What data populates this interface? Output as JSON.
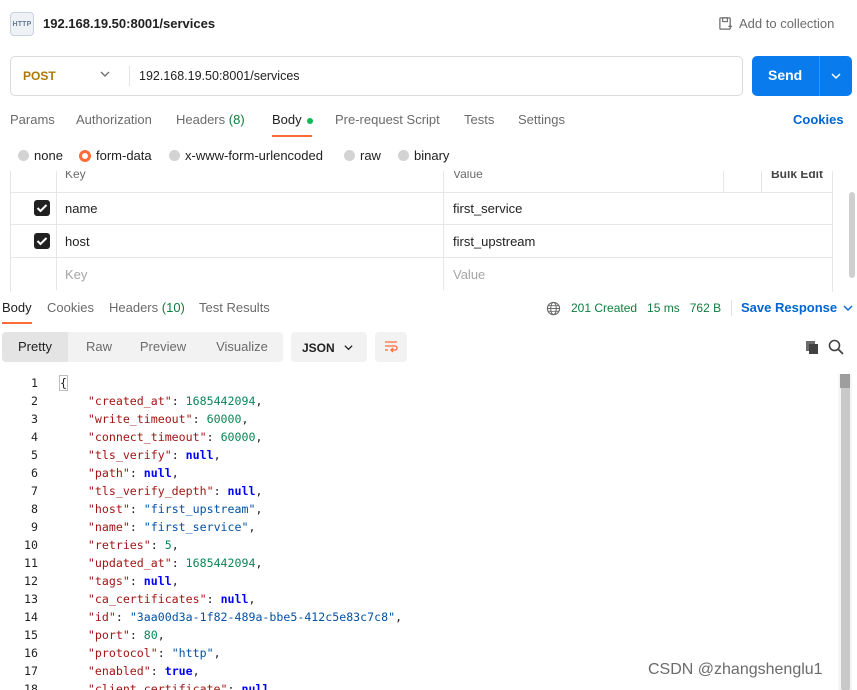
{
  "request": {
    "title": "192.168.19.50:8001/services",
    "icon_label": "HTTP",
    "add_to_collection": "Add to collection",
    "method": "POST",
    "url": "192.168.19.50:8001/services",
    "send_label": "Send"
  },
  "req_tabs": {
    "params": "Params",
    "authorization": "Authorization",
    "headers": "Headers",
    "headers_count": "(8)",
    "body": "Body",
    "pre_request": "Pre-request Script",
    "tests": "Tests",
    "settings": "Settings",
    "cookies": "Cookies"
  },
  "body_modes": {
    "none": "none",
    "form_data": "form-data",
    "urlencoded": "x-www-form-urlencoded",
    "raw": "raw",
    "binary": "binary",
    "selected": "form-data"
  },
  "form_table": {
    "headers": [
      "Key",
      "Value",
      "Bulk Edit"
    ],
    "rows": [
      {
        "key": "name",
        "value": "first_service",
        "checked": true
      },
      {
        "key": "host",
        "value": "first_upstream",
        "checked": true
      }
    ],
    "placeholder_key": "Key",
    "placeholder_value": "Value"
  },
  "response": {
    "tabs": {
      "body": "Body",
      "cookies": "Cookies",
      "headers": "Headers",
      "headers_count": "(10)",
      "test_results": "Test Results"
    },
    "status": "201 Created",
    "time": "15 ms",
    "size": "762 B",
    "save_response": "Save Response",
    "views": {
      "pretty": "Pretty",
      "raw": "Raw",
      "preview": "Preview",
      "visualize": "Visualize"
    },
    "format": "JSON"
  },
  "code_lines": [
    {
      "num": "1",
      "type": "open",
      "text": "{"
    },
    {
      "num": "2",
      "type": "num",
      "key": "created_at",
      "value": "1685442094"
    },
    {
      "num": "3",
      "type": "num",
      "key": "write_timeout",
      "value": "60000"
    },
    {
      "num": "4",
      "type": "num",
      "key": "connect_timeout",
      "value": "60000"
    },
    {
      "num": "5",
      "type": "null",
      "key": "tls_verify",
      "value": "null"
    },
    {
      "num": "6",
      "type": "null",
      "key": "path",
      "value": "null"
    },
    {
      "num": "7",
      "type": "null",
      "key": "tls_verify_depth",
      "value": "null"
    },
    {
      "num": "8",
      "type": "str",
      "key": "host",
      "value": "first_upstream"
    },
    {
      "num": "9",
      "type": "str",
      "key": "name",
      "value": "first_service"
    },
    {
      "num": "10",
      "type": "num",
      "key": "retries",
      "value": "5"
    },
    {
      "num": "11",
      "type": "num",
      "key": "updated_at",
      "value": "1685442094"
    },
    {
      "num": "12",
      "type": "null",
      "key": "tags",
      "value": "null"
    },
    {
      "num": "13",
      "type": "null",
      "key": "ca_certificates",
      "value": "null"
    },
    {
      "num": "14",
      "type": "str",
      "key": "id",
      "value": "3aa00d3a-1f82-489a-bbe5-412c5e83c7c8"
    },
    {
      "num": "15",
      "type": "num",
      "key": "port",
      "value": "80"
    },
    {
      "num": "16",
      "type": "str",
      "key": "protocol",
      "value": "http"
    },
    {
      "num": "17",
      "type": "null",
      "key": "enabled",
      "value": "true"
    },
    {
      "num": "18",
      "type": "null",
      "key": "client_certificate",
      "value": "null"
    }
  ],
  "watermark": "CSDN @zhangshenglu1",
  "colors": {
    "accent_orange": "#ff6c37",
    "send_blue": "#097bed",
    "link_blue": "#0265d2",
    "status_green": "#0f7d3d",
    "method_post": "#ad7a03"
  },
  "icons": {
    "request_type": "http-icon",
    "add_collection": "save-icon",
    "method_dropdown": "chevron-down-icon",
    "send_dropdown": "chevron-down-icon",
    "status": "globe-icon",
    "wrap": "wrap-lines-icon",
    "copy": "copy-icon",
    "search": "search-icon"
  }
}
